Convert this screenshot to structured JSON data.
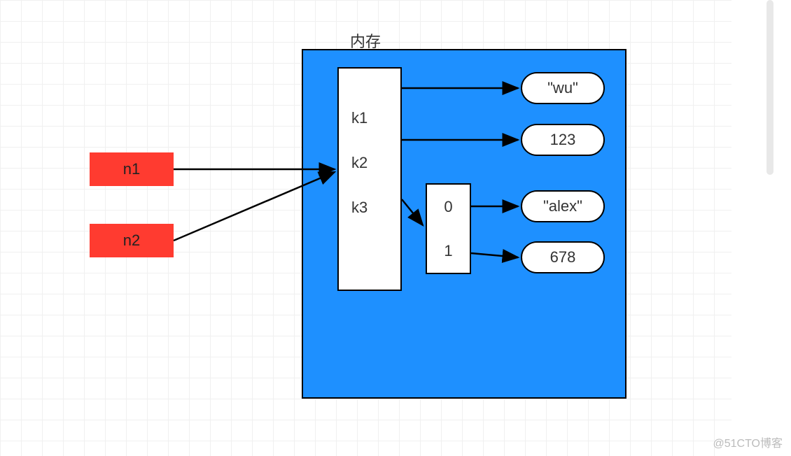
{
  "title": "内存",
  "variables": {
    "n1": "n1",
    "n2": "n2"
  },
  "dict_keys": {
    "k1": "k1",
    "k2": "k2",
    "k3": "k3"
  },
  "list_indices": {
    "i0": "0",
    "i1": "1"
  },
  "values": {
    "wu": "\"wu\"",
    "v123": "123",
    "alex": "\"alex\"",
    "v678": "678"
  },
  "watermark": "@51CTO博客"
}
